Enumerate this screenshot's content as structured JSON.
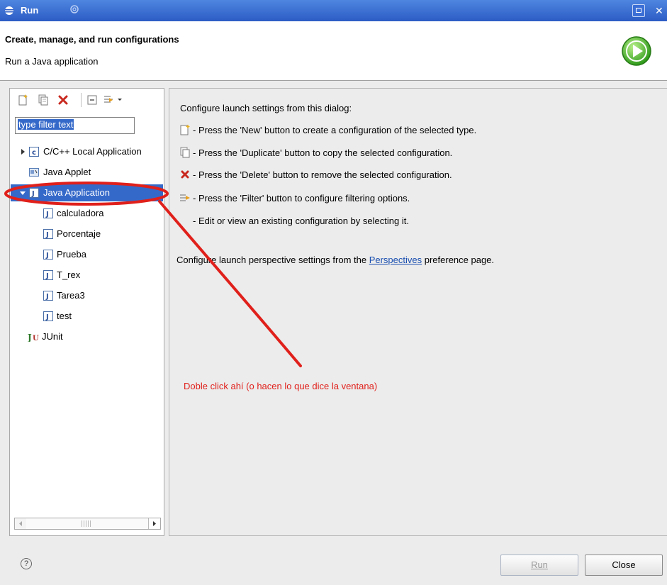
{
  "window": {
    "title": "Run"
  },
  "header": {
    "title": "Create, manage, and run configurations",
    "subtitle": "Run a Java application"
  },
  "filter": {
    "value": "type filter text"
  },
  "tree": {
    "items": [
      {
        "label": "C/C++ Local Application",
        "icon": "c-app-icon",
        "expanded": false
      },
      {
        "label": "Java Applet",
        "icon": "applet-icon"
      },
      {
        "label": "Java Application",
        "icon": "java-app-icon",
        "expanded": true,
        "selected": true
      },
      {
        "label": "calculadora",
        "icon": "java-app-icon"
      },
      {
        "label": "Porcentaje",
        "icon": "java-app-icon"
      },
      {
        "label": "Prueba",
        "icon": "java-app-icon"
      },
      {
        "label": "T_rex",
        "icon": "java-app-icon"
      },
      {
        "label": "Tarea3",
        "icon": "java-app-icon"
      },
      {
        "label": "test",
        "icon": "java-app-icon"
      },
      {
        "label": "JUnit",
        "icon": "junit-icon"
      }
    ]
  },
  "info": {
    "intro": "Configure launch settings from this dialog:",
    "new_text": "- Press the 'New' button to create a configuration of the selected type.",
    "duplicate_text": "- Press the 'Duplicate' button to copy the selected configuration.",
    "delete_text": "- Press the 'Delete' button to remove the selected configuration.",
    "filter_text": "- Press the 'Filter' button to configure filtering options.",
    "edit_text": "- Edit or view an existing configuration by selecting it.",
    "perspective_before": "Configure launch perspective settings from the ",
    "perspective_link": "Perspectives",
    "perspective_after": " preference page."
  },
  "annotation": {
    "text": "Doble click ahí (o hacen lo que dice la ventana)"
  },
  "footer": {
    "help_glyph": "?",
    "run_label": "Run",
    "close_label": "Close"
  },
  "colors": {
    "selection": "#3569c9",
    "annotation": "#e0201b",
    "titlebar": "#2c5cc4",
    "link": "#1a4fb0"
  }
}
